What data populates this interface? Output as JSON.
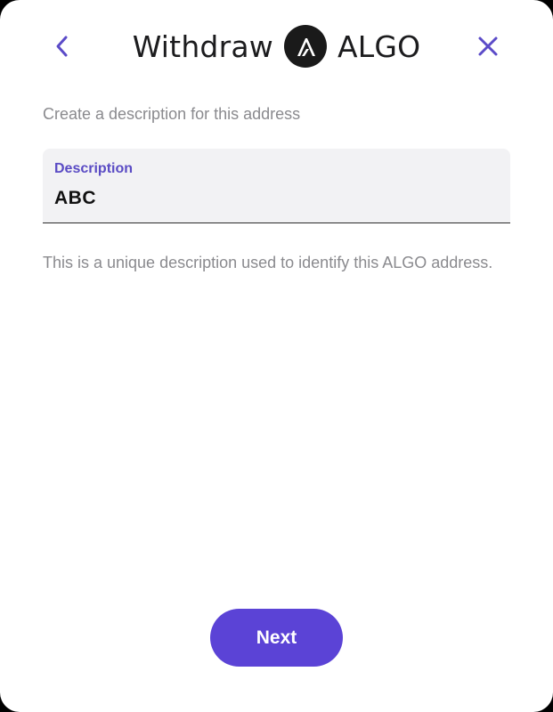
{
  "header": {
    "title_prefix": "Withdraw",
    "title_suffix": "ALGO",
    "back_icon": "chevron-left-icon",
    "close_icon": "close-icon",
    "logo_icon": "algorand-logo-icon"
  },
  "form": {
    "prompt": "Create a description for this address",
    "description_label": "Description",
    "description_value": "ABC",
    "helper_text": "This is a unique description used to identify this ALGO address."
  },
  "footer": {
    "next_label": "Next"
  },
  "colors": {
    "accent": "#5b43d6",
    "label_purple": "#5a4bc4",
    "icon_purple": "#5b4bc8",
    "muted_text": "#8a8a8e",
    "field_bg": "#f2f2f4"
  }
}
